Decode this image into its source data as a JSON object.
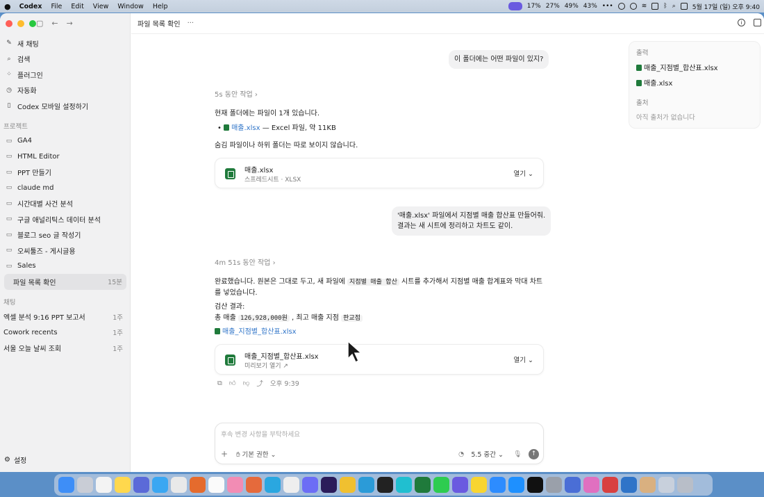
{
  "menubar": {
    "app": "Codex",
    "items": [
      "File",
      "Edit",
      "View",
      "Window",
      "Help"
    ],
    "stats": [
      "17%",
      "27%",
      "49%",
      "43%"
    ],
    "clock": "5월 17일 (일) 오후 9:40"
  },
  "sidebar": {
    "top": [
      {
        "label": "새 채팅",
        "icon": "compose-icon"
      },
      {
        "label": "검색",
        "icon": "search-icon"
      },
      {
        "label": "플러그인",
        "icon": "grid-icon"
      },
      {
        "label": "자동화",
        "icon": "clock-icon"
      },
      {
        "label": "Codex 모바일 설정하기",
        "icon": "phone-icon"
      }
    ],
    "projects_label": "프로젝트",
    "projects": [
      "GA4",
      "HTML Editor",
      "PPT 만들기",
      "claude md",
      "시간대별 사건 분석",
      "구글 애널리틱스 데이터 분석",
      "블로그 seo 글 작성기",
      "오씨툴즈 - 게시글용",
      "Sales"
    ],
    "active_chat": {
      "label": "파일 목록 확인",
      "time": "15분"
    },
    "chats_label": "채팅",
    "chats": [
      {
        "label": "엑셀 분석 9:16 PPT 보고서",
        "time": "1주"
      },
      {
        "label": "Cowork recents",
        "time": "1주"
      },
      {
        "label": "서울 오늘 날씨 조회",
        "time": "1주"
      }
    ],
    "settings": "설정"
  },
  "header": {
    "title": "파일 목록 확인",
    "more": "···"
  },
  "conversation": {
    "user_msg_1": "이 폴더에는 어떤 파일이 있지?",
    "work_1": "5s 동안 작업",
    "reply_1_line1": "현재 폴더에는 파일이 1개 있습니다.",
    "reply_1_file": "매출.xlsx",
    "reply_1_file_desc": "— Excel 파일, 약 11KB",
    "reply_1_line3": "숨김 파일이나 하위 폴더는 따로 보이지 않습니다.",
    "card_1": {
      "name": "매출.xlsx",
      "sub": "스프레드시트 · XLSX",
      "open": "열기"
    },
    "user_msg_2_line1": "'매출.xlsx' 파일에서 지점별 매출 합산표 만들어줘.",
    "user_msg_2_line2": "결과는 새 시트에 정리하고 차트도 같이.",
    "work_2": "4m 51s 동안 작업",
    "reply_2_a": "완료했습니다. 원본은 그대로 두고, 새 파일에",
    "reply_2_code": "지점별 매출 합산",
    "reply_2_b": "시트를 추가해서 지점별 매출 합계표와 막대 차트를",
    "reply_2_c": "넣었습니다.",
    "verify_label": "검산 결과:",
    "verify_a": "총 매출",
    "verify_total": "126,928,000원",
    "verify_b": ", 최고 매출 지점",
    "verify_top": "판교점",
    "result_file": "매출_지점별_합산표.xlsx",
    "card_2": {
      "name": "매출_지점별_합산표.xlsx",
      "sub": "미리보기 열기 ↗",
      "open": "열기"
    },
    "timestamp": "오후 9:39"
  },
  "right_panel": {
    "output_label": "출력",
    "outputs": [
      "매출_지점별_합산표.xlsx",
      "매출.xlsx"
    ],
    "sources_label": "출처",
    "sources_empty": "아직 출처가 없습니다"
  },
  "composer": {
    "placeholder": "후속 변경 사항을 부탁하세요",
    "permission": "기본 권한",
    "model": "5.5 중간"
  }
}
